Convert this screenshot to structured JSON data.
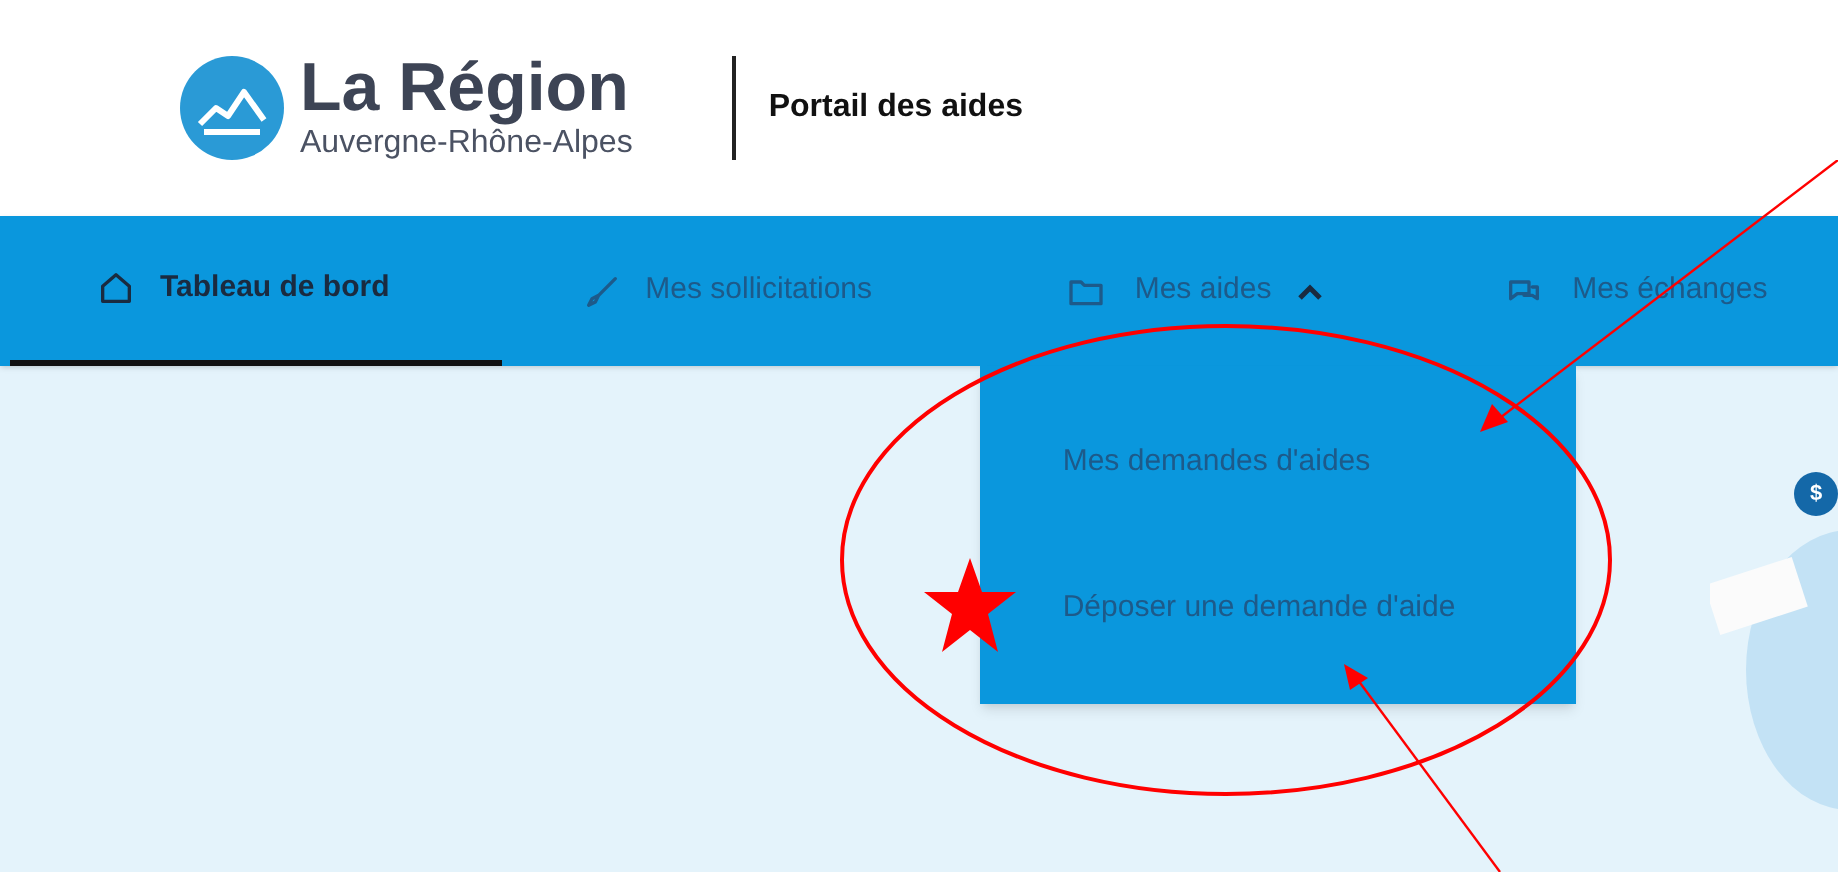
{
  "header": {
    "logo_title": "La Région",
    "logo_subtitle": "Auvergne-Rhône-Alpes",
    "portal_title": "Portail des aides"
  },
  "nav": {
    "tabs": [
      {
        "label": "Tableau de bord",
        "selected": true
      },
      {
        "label": "Mes sollicitations",
        "selected": false
      },
      {
        "label": "Mes aides",
        "selected": false,
        "expanded": true,
        "menu": [
          "Mes demandes d'aides",
          "Déposer une demande d'aide"
        ]
      },
      {
        "label": "Mes échanges",
        "selected": false
      }
    ]
  },
  "illustration": {
    "coin": "$"
  }
}
